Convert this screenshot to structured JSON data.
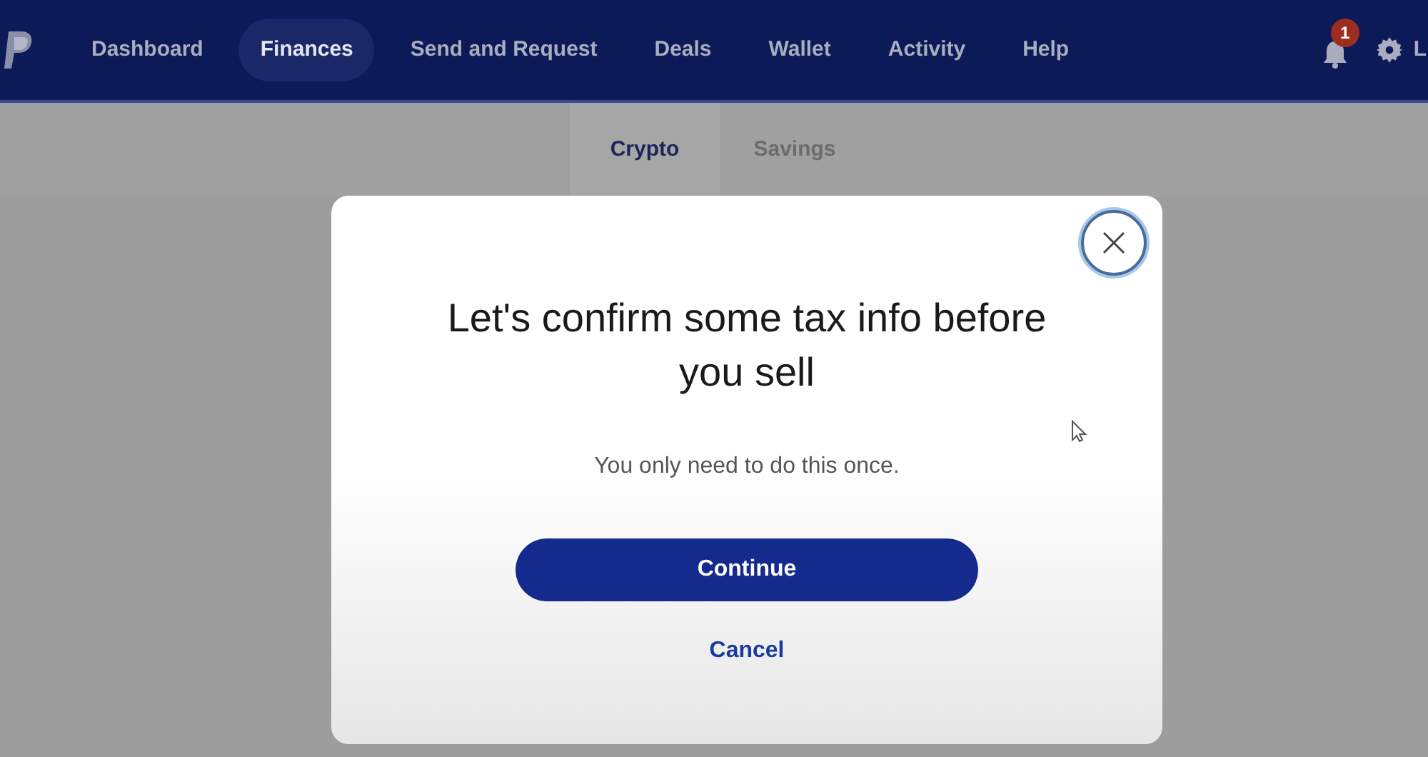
{
  "nav": {
    "items": [
      {
        "label": "Dashboard",
        "selected": false
      },
      {
        "label": "Finances",
        "selected": true
      },
      {
        "label": "Send and Request",
        "selected": false
      },
      {
        "label": "Deals",
        "selected": false
      },
      {
        "label": "Wallet",
        "selected": false
      },
      {
        "label": "Activity",
        "selected": false
      },
      {
        "label": "Help",
        "selected": false
      }
    ],
    "notification_count": "1",
    "user_menu": "L"
  },
  "sub_tabs": [
    {
      "label": "Crypto",
      "selected": true
    },
    {
      "label": "Savings",
      "selected": false
    }
  ],
  "dialog": {
    "title": "Let's confirm some tax info before you sell",
    "message": "You only need to do this once.",
    "primary_button": "Continue",
    "secondary_button": "Cancel"
  }
}
